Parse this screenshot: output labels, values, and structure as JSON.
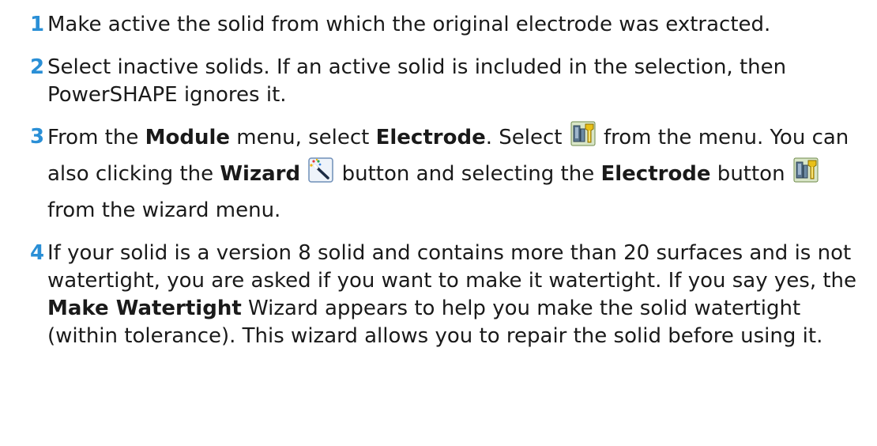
{
  "steps": [
    {
      "number": "1",
      "text": "Make active the solid from which the original electrode was extracted."
    },
    {
      "number": "2",
      "text": "Select inactive solids. If an active solid is included in the selection, then PowerSHAPE ignores it."
    },
    {
      "number": "3",
      "p1": "From the ",
      "module": "Module",
      "p2": " menu, select ",
      "electrode": "Electrode",
      "p3": ". Select ",
      "p4": " from the menu. You can also clicking the ",
      "wizard": "Wizard",
      "p5": " button  and selecting the ",
      "electrode2": "Electrode",
      "p6": " button ",
      "p7": " from the wizard menu."
    },
    {
      "number": "4",
      "p1": "If your solid is a version 8 solid and contains more than 20 surfaces and is not watertight, you are asked if you want to make it watertight. If you say yes, the ",
      "make_watertight": "Make Watertight",
      "p2": " Wizard appears to help you make the solid watertight (within tolerance). This wizard allows you to repair the solid before using it."
    }
  ],
  "icons": {
    "electrode": "electrode-icon",
    "wizard": "wizard-wand-icon"
  },
  "colors": {
    "step_number": "#2a8fd6",
    "text": "#1a1a1a"
  }
}
